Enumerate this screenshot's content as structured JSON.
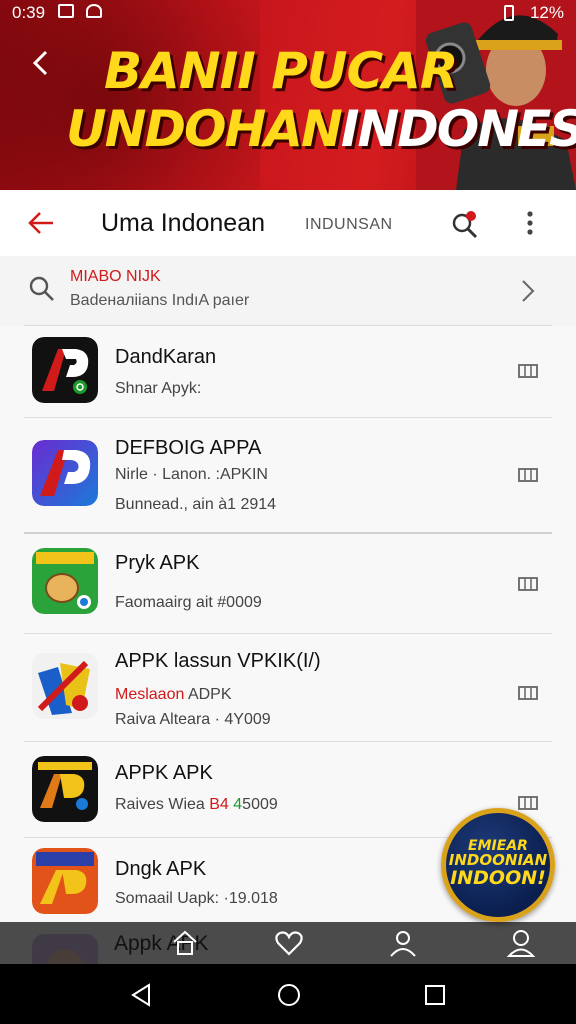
{
  "status_bar": {
    "time": "0:39",
    "battery": "12%"
  },
  "banner": {
    "line1": "BANII PUCAR",
    "line2_a": "UNDOHAN",
    "line2_b": "INDONESIA"
  },
  "app_bar": {
    "title": "Uma Indonean",
    "subtitle": "INDUNSAN"
  },
  "search": {
    "title": "MIABO NIJK",
    "subtitle": "Badeналiians  IndıA paıer"
  },
  "apps": [
    {
      "name": "DandKaran",
      "line1": "Shnar Apyk:"
    },
    {
      "name": "DEFBOIG APPA",
      "line1": "Nirle · Lanon. :APKIN",
      "line2": "Bunnead., ain à1 2914"
    },
    {
      "name": "Pryk APK",
      "line1": "Faomaairg ait #0009"
    },
    {
      "name": "APPK lassun VPKIK(I/)",
      "line1_red": "Meslaaon",
      "line1_rest": " ADPK",
      "line2": "Raiva Alteara · 4Y009"
    },
    {
      "name": "APPK APK",
      "line1_a": "Raives Wiea ",
      "line1_red": "B4",
      "line1_green": " 4",
      "line1_b": "5009"
    },
    {
      "name": "Dngk APK",
      "line1": "Somaail Uapk: ·19.018"
    },
    {
      "name": "Appk APK"
    }
  ],
  "badge": {
    "line1": "EMIEAR",
    "line2": "INDOONIAN",
    "line3": "INDOON!"
  },
  "colors": {
    "accent_red": "#d11a1a",
    "banner_red": "#c4141b",
    "banner_yellow": "#ffd91a"
  },
  "icons": {
    "appbar": [
      "back-arrow-icon",
      "search-icon",
      "more-vertical-icon"
    ],
    "tabs": [
      "home-icon",
      "heart-icon",
      "person-icon",
      "account-icon"
    ],
    "nav": [
      "nav-back-icon",
      "nav-home-icon",
      "nav-recents-icon"
    ]
  }
}
